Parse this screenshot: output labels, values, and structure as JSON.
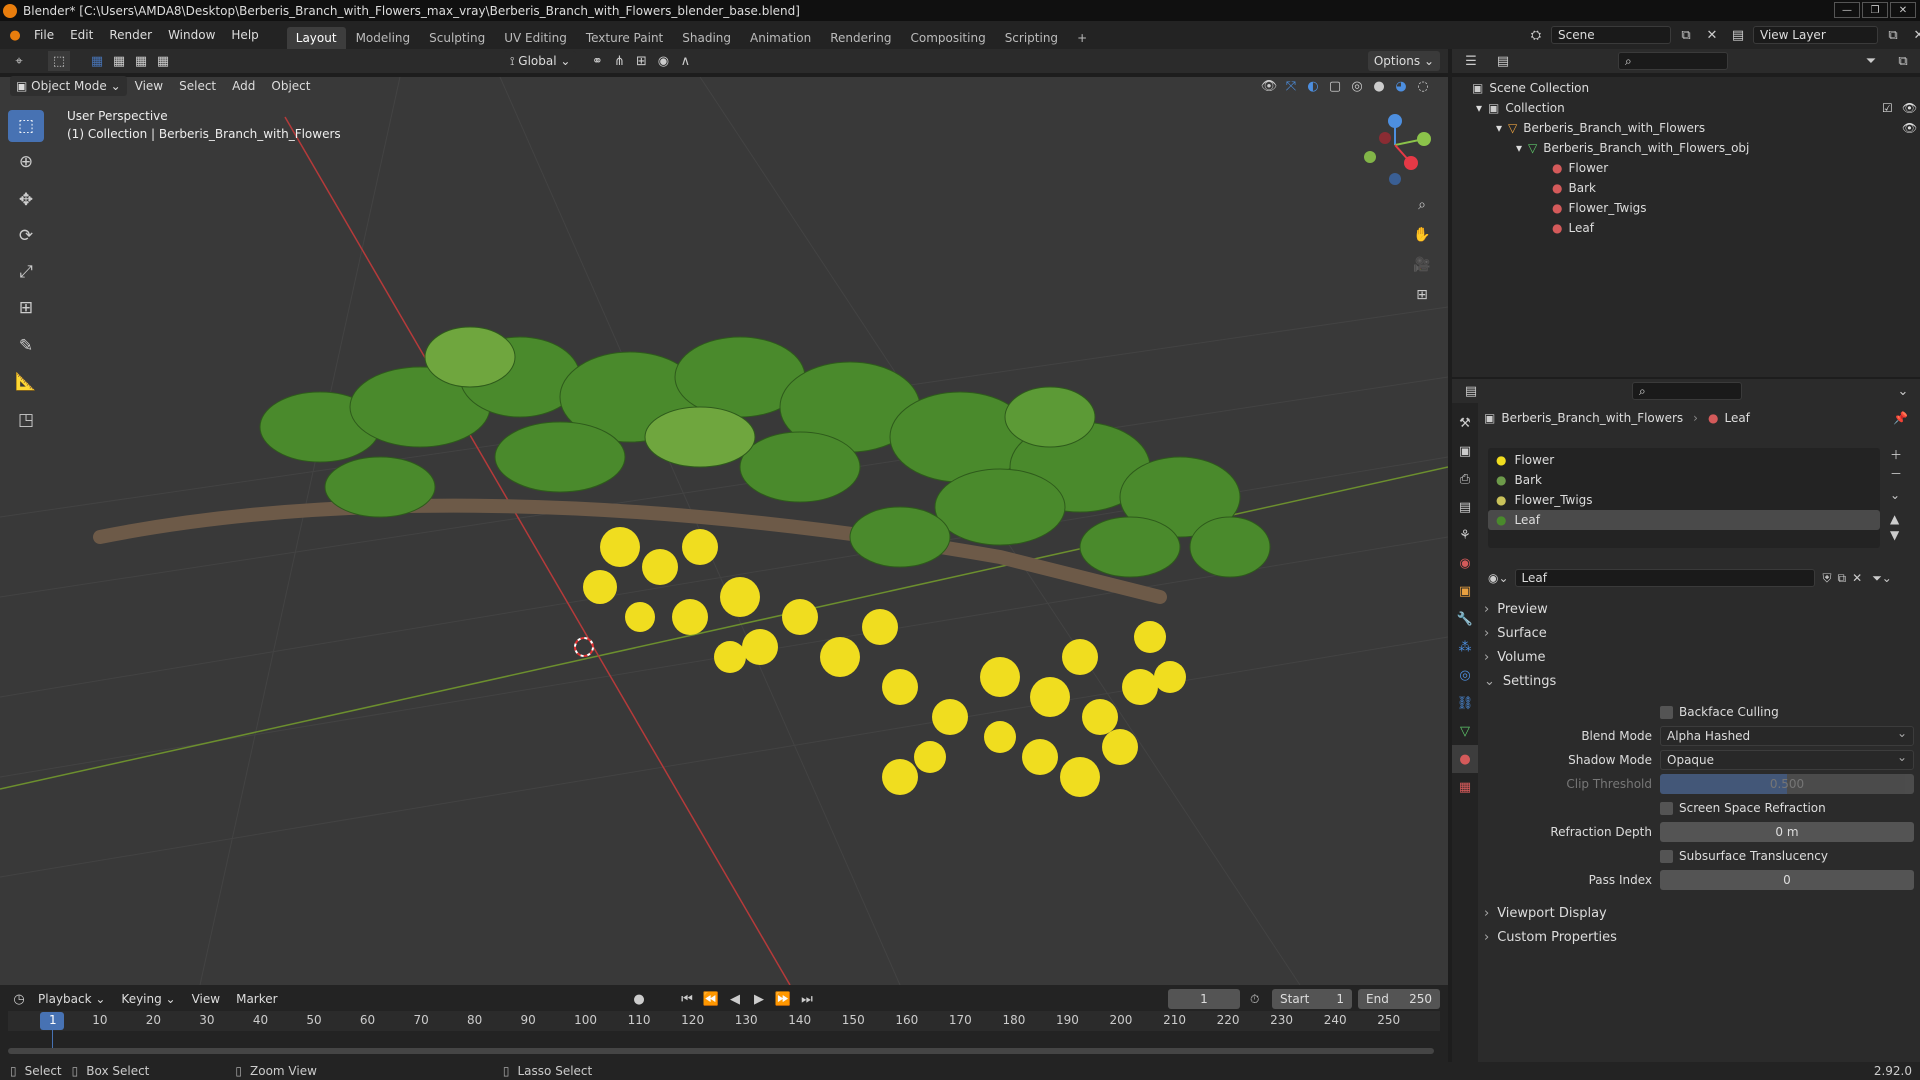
{
  "window": {
    "title": "Blender* [C:\\Users\\AMDA8\\Desktop\\Berberis_Branch_with_Flowers_max_vray\\Berberis_Branch_with_Flowers_blender_base.blend]"
  },
  "menu": [
    "File",
    "Edit",
    "Render",
    "Window",
    "Help"
  ],
  "workspaces": [
    "Layout",
    "Modeling",
    "Sculpting",
    "UV Editing",
    "Texture Paint",
    "Shading",
    "Animation",
    "Rendering",
    "Compositing",
    "Scripting"
  ],
  "scene": {
    "name": "Scene",
    "view_layer": "View Layer"
  },
  "tool_header": {
    "orientation": "Global",
    "options": "Options"
  },
  "viewport_header": {
    "mode": "Object Mode",
    "menus": [
      "View",
      "Select",
      "Add",
      "Object"
    ]
  },
  "viewport": {
    "perspective": "User Perspective",
    "collection_info": "(1) Collection | Berberis_Branch_with_Flowers"
  },
  "outliner": {
    "root": "Scene Collection",
    "collection": "Collection",
    "object": "Berberis_Branch_with_Flowers",
    "mesh": "Berberis_Branch_with_Flowers_obj",
    "materials": [
      "Flower",
      "Bark",
      "Flower_Twigs",
      "Leaf"
    ]
  },
  "properties": {
    "breadcrumb_object": "Berberis_Branch_with_Flowers",
    "breadcrumb_material": "Leaf",
    "slots": [
      "Flower",
      "Bark",
      "Flower_Twigs",
      "Leaf"
    ],
    "active_material": "Leaf",
    "panels": {
      "preview": "Preview",
      "surface": "Surface",
      "volume": "Volume",
      "settings": "Settings",
      "viewport_display": "Viewport Display",
      "custom_properties": "Custom Properties"
    },
    "settings": {
      "backface_culling": "Backface Culling",
      "blend_mode_label": "Blend Mode",
      "blend_mode": "Alpha Hashed",
      "shadow_mode_label": "Shadow Mode",
      "shadow_mode": "Opaque",
      "clip_threshold_label": "Clip Threshold",
      "clip_threshold": "0.500",
      "ssr": "Screen Space Refraction",
      "refraction_depth_label": "Refraction Depth",
      "refraction_depth": "0 m",
      "subsurface": "Subsurface Translucency",
      "pass_index_label": "Pass Index",
      "pass_index": "0"
    }
  },
  "timeline": {
    "menus": [
      "Playback",
      "Keying",
      "View",
      "Marker"
    ],
    "current_frame": "1",
    "start_label": "Start",
    "start": "1",
    "end_label": "End",
    "end": "250",
    "ticks": [
      "1",
      "10",
      "20",
      "30",
      "40",
      "50",
      "60",
      "70",
      "80",
      "90",
      "100",
      "110",
      "120",
      "130",
      "140",
      "150",
      "160",
      "170",
      "180",
      "190",
      "200",
      "210",
      "220",
      "230",
      "240",
      "250"
    ]
  },
  "statusbar": {
    "select": "Select",
    "box_select": "Box Select",
    "zoom_view": "Zoom View",
    "lasso_select": "Lasso Select",
    "version": "2.92.0"
  },
  "colors": {
    "accent": "#4772b3",
    "x_axis": "#e63946",
    "y_axis": "#8bc34a",
    "z_axis": "#4d8fe0",
    "flower": "#f0dd1f",
    "leaf": "#4a8a2c"
  }
}
